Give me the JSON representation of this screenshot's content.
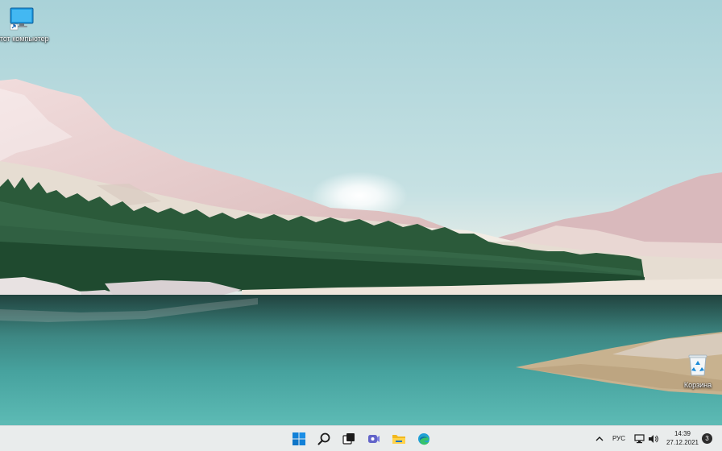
{
  "desktop": {
    "icons": [
      {
        "id": "this-pc",
        "label": "Этот компьютер",
        "icon": "monitor-icon"
      },
      {
        "id": "recycle-bin",
        "label": "Корзина",
        "icon": "recycle-bin-icon"
      }
    ]
  },
  "taskbar": {
    "apps": [
      {
        "name": "start",
        "icon": "windows-logo-icon"
      },
      {
        "name": "search",
        "icon": "search-icon"
      },
      {
        "name": "task-view",
        "icon": "task-view-icon"
      },
      {
        "name": "chat",
        "icon": "teams-chat-icon"
      },
      {
        "name": "file-explorer",
        "icon": "folder-icon"
      },
      {
        "name": "edge",
        "icon": "edge-icon"
      }
    ],
    "tray": {
      "overflow_icon": "chevron-up-icon",
      "language": "РУС",
      "network_icon": "network-icon",
      "volume_icon": "volume-icon",
      "time": "14:39",
      "date": "27.12.2021",
      "notifications": "3"
    },
    "colors": {
      "background": "#e9ecec",
      "accent": "#0f7bd6"
    }
  }
}
